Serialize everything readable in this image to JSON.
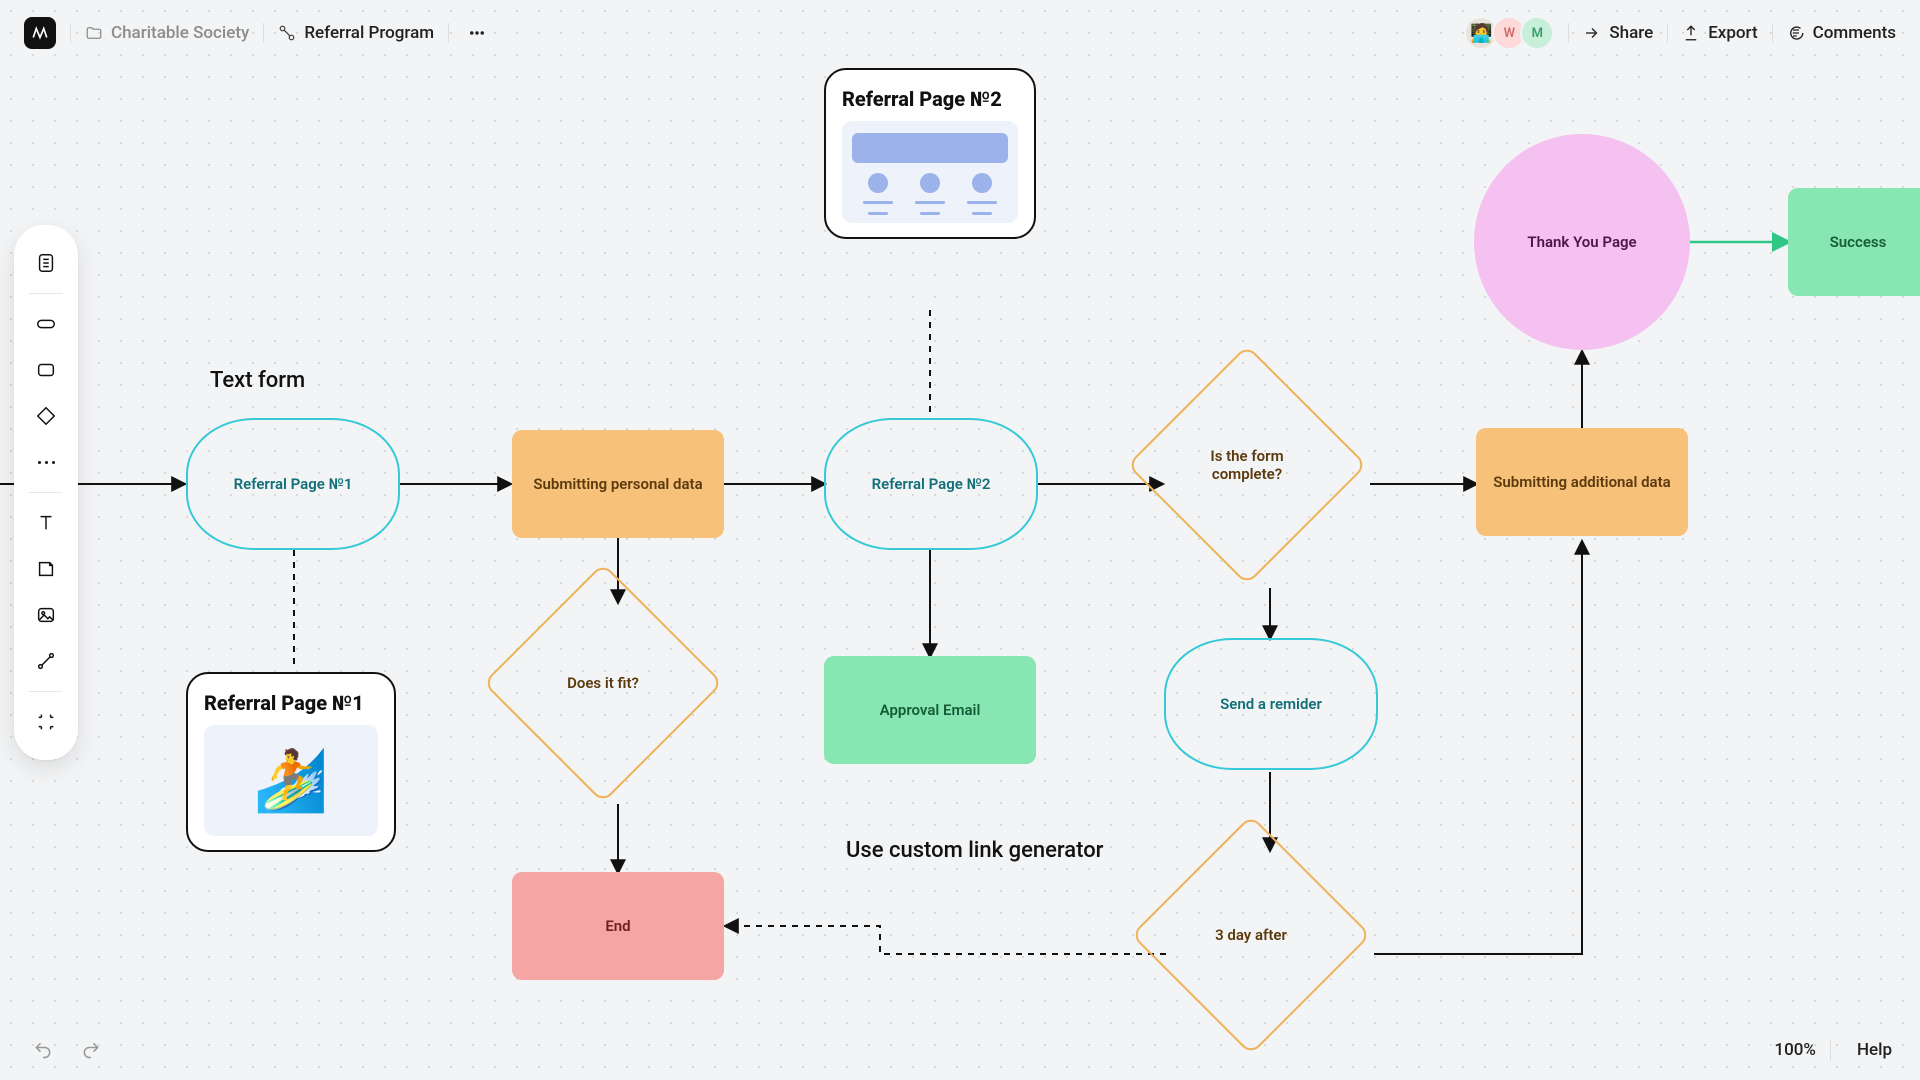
{
  "header": {
    "project": "Charitable Society",
    "page": "Referral Program",
    "actions": {
      "share": "Share",
      "export": "Export",
      "comments": "Comments"
    },
    "avatars": [
      {
        "id": "photo",
        "label": ""
      },
      {
        "id": "w",
        "label": "W"
      },
      {
        "id": "m",
        "label": "M"
      }
    ]
  },
  "footer": {
    "zoom": "100%",
    "help": "Help"
  },
  "labels": {
    "text_form": "Text form",
    "custom_link": "Use custom link generator"
  },
  "cards": {
    "ref1": {
      "title": "Referral Page №1"
    },
    "ref2": {
      "title": "Referral Page №2"
    }
  },
  "nodes": {
    "ref_page_1": "Referral Page №1",
    "submit_personal": "Submitting personal data",
    "ref_page_2": "Referral Page №2",
    "form_complete": "Is the form complete?",
    "submit_additional": "Submitting additional data",
    "thank_you": "Thank You Page",
    "success": "Success",
    "does_it_fit": "Does it fit?",
    "approval_email": "Approval Email",
    "send_reminder": "Send a remider",
    "three_day": "3 day after",
    "end": "End"
  },
  "chart_data": {
    "type": "flowchart",
    "title": "Referral Program",
    "annotations": [
      "Text form",
      "Use custom link generator"
    ],
    "nodes": [
      {
        "id": "start",
        "label": "",
        "shape": "start"
      },
      {
        "id": "ref_page_1",
        "label": "Referral Page №1",
        "shape": "terminator"
      },
      {
        "id": "submit_personal",
        "label": "Submitting personal data",
        "shape": "process"
      },
      {
        "id": "ref_page_2_node",
        "label": "Referral Page №2",
        "shape": "terminator"
      },
      {
        "id": "form_complete",
        "label": "Is the form complete?",
        "shape": "decision"
      },
      {
        "id": "submit_additional",
        "label": "Submitting additional data",
        "shape": "process"
      },
      {
        "id": "thank_you",
        "label": "Thank You Page",
        "shape": "circle"
      },
      {
        "id": "success",
        "label": "Success",
        "shape": "process"
      },
      {
        "id": "does_it_fit",
        "label": "Does it fit?",
        "shape": "decision"
      },
      {
        "id": "end",
        "label": "End",
        "shape": "process"
      },
      {
        "id": "approval_email",
        "label": "Approval Email",
        "shape": "process"
      },
      {
        "id": "send_reminder",
        "label": "Send a remider",
        "shape": "terminator"
      },
      {
        "id": "three_day",
        "label": "3 day after",
        "shape": "decision"
      },
      {
        "id": "card_ref1",
        "label": "Referral Page №1",
        "shape": "preview-card"
      },
      {
        "id": "card_ref2",
        "label": "Referral Page №2",
        "shape": "preview-card"
      }
    ],
    "edges": [
      {
        "from": "start",
        "to": "ref_page_1",
        "style": "solid"
      },
      {
        "from": "ref_page_1",
        "to": "submit_personal",
        "style": "solid"
      },
      {
        "from": "submit_personal",
        "to": "ref_page_2_node",
        "style": "solid"
      },
      {
        "from": "ref_page_2_node",
        "to": "form_complete",
        "style": "solid"
      },
      {
        "from": "form_complete",
        "to": "submit_additional",
        "style": "solid"
      },
      {
        "from": "submit_additional",
        "to": "thank_you",
        "style": "solid"
      },
      {
        "from": "thank_you",
        "to": "success",
        "style": "solid",
        "color": "#2fc786"
      },
      {
        "from": "submit_personal",
        "to": "does_it_fit",
        "style": "solid"
      },
      {
        "from": "does_it_fit",
        "to": "end",
        "style": "solid"
      },
      {
        "from": "ref_page_2_node",
        "to": "approval_email",
        "style": "solid"
      },
      {
        "from": "form_complete",
        "to": "send_reminder",
        "style": "solid"
      },
      {
        "from": "send_reminder",
        "to": "three_day",
        "style": "solid"
      },
      {
        "from": "three_day",
        "to": "submit_additional",
        "style": "solid",
        "path": "orthogonal"
      },
      {
        "from": "three_day",
        "to": "end",
        "style": "dashed",
        "path": "orthogonal"
      },
      {
        "from": "ref_page_1",
        "to": "card_ref1",
        "style": "dashed"
      },
      {
        "from": "card_ref2",
        "to": "ref_page_2_node",
        "style": "dashed"
      }
    ]
  }
}
